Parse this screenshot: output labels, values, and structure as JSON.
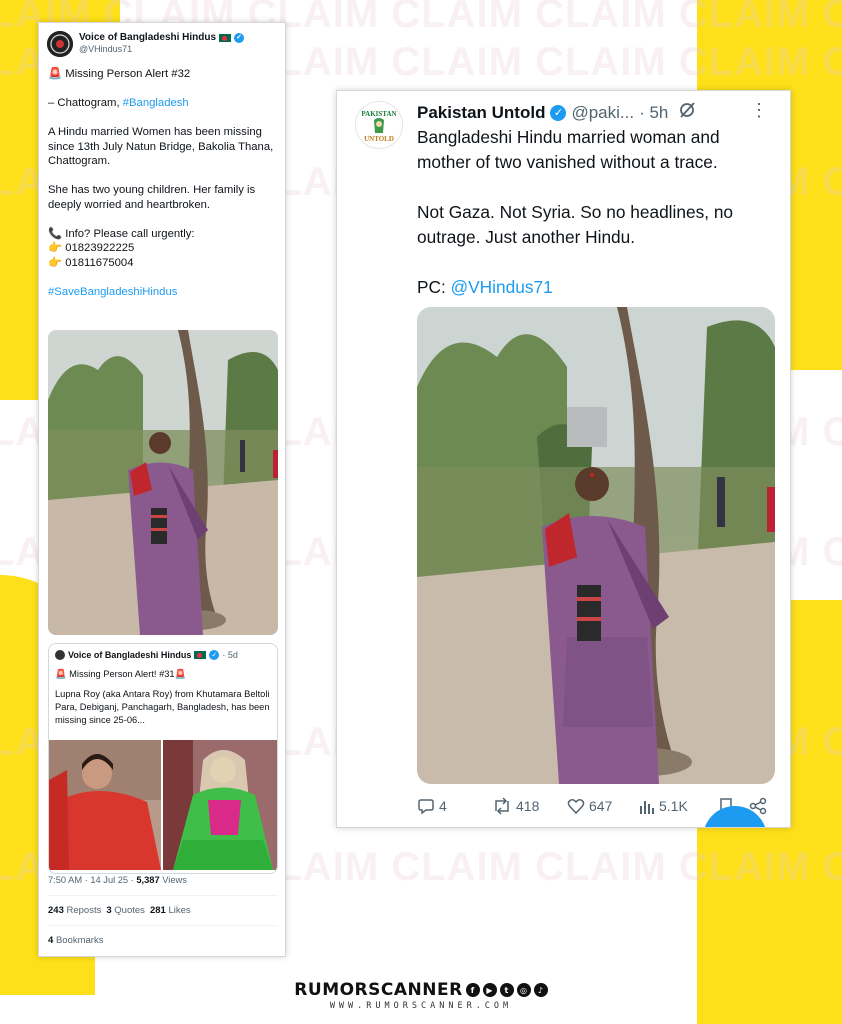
{
  "watermark_text": "CLAIM CLAIM CLAIM CLAIM CLAIM CLAIM CLAIM",
  "left_tweet": {
    "author_name": "Voice of Bangladeshi Hindus",
    "handle": "@VHindus71",
    "alert_line": "🚨 Missing Person Alert #32",
    "location_prefix": "– Chattogram, ",
    "location_hashtag": "#Bangladesh",
    "para1": "A Hindu married Women  has been missing since 13th July  Natun Bridge, Bakolia Thana, Chattogram.",
    "para2": "She has two young children. Her family is deeply worried and heartbroken.",
    "info_line": "📞 Info? Please call urgently:",
    "phone1": "👉 01823922225",
    "phone2": "👉 01811675004",
    "hashtag": "#SaveBangladeshiHindus",
    "quote": {
      "author_name": "Voice of Bangladeshi Hindus",
      "age": "· 5d",
      "alert_line": "🚨 Missing Person Alert!  #31🚨",
      "text": "Lupna Roy (aka Antara Roy) from Khutamara Beltoli Para, Debiganj, Panchagarh, Bangladesh, has been missing since 25-06..."
    },
    "timestamp": "7:50 AM · 14 Jul 25 · ",
    "views_count": "5,387",
    "views_label": " Views",
    "reposts_count": "243",
    "reposts_label": "Reposts",
    "quotes_count": "3",
    "quotes_label": "Quotes",
    "likes_count": "281",
    "likes_label": "Likes",
    "bookmarks_count": "4",
    "bookmarks_label": "Bookmarks"
  },
  "right_tweet": {
    "author_name": "Pakistan Untold",
    "handle": "@paki...",
    "age": "· 5h",
    "logo_text_top": "PAKISTAN",
    "logo_text_bottom": "UNTOLD",
    "para1": "Bangladeshi Hindu married woman and mother of two vanished without a trace.",
    "para2": "Not Gaza. Not Syria. So no headlines, no outrage. Just another Hindu.",
    "pc_prefix": "PC: ",
    "pc_handle": "@VHindus71",
    "replies": "4",
    "reposts": "418",
    "likes": "647",
    "views": "5.1K"
  },
  "footer": {
    "brand": "RUMORSCANNER",
    "site": "WWW.RUMORSCANNER.COM"
  },
  "colors": {
    "accent_yellow": "#fde019",
    "twitter_blue": "#1d9bf0",
    "saree_purple": "#8a5a8e",
    "blouse_red": "#c0272d"
  }
}
